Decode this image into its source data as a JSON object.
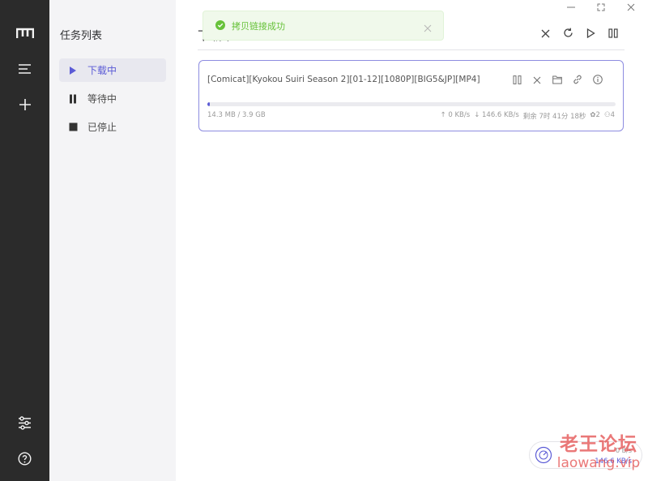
{
  "rail": {
    "logo_icon": "app-logo-m",
    "items": [
      "task-list-icon",
      "add-task-icon"
    ],
    "bottom": [
      "settings-sliders-icon",
      "help-icon"
    ]
  },
  "nav": {
    "title": "任务列表",
    "items": [
      {
        "label": "下载中",
        "icon": "play-icon",
        "active": true
      },
      {
        "label": "等待中",
        "icon": "pause-icon",
        "active": false
      },
      {
        "label": "已停止",
        "icon": "stop-icon",
        "active": false
      }
    ]
  },
  "header": {
    "title": "下载中",
    "actions": [
      "close-icon",
      "refresh-icon",
      "resume-all-icon",
      "pause-all-icon"
    ]
  },
  "toast": {
    "message": "拷贝链接成功",
    "type": "success"
  },
  "task": {
    "name": "[Comicat][Kyokou Suiri Season 2][01-12][1080P][BIG5&JP][MP4]",
    "size": "14.3 MB / 3.9 GB",
    "progress_fraction": 0.004,
    "upload_speed": "↑ 0 KB/s",
    "download_speed": "↓ 146.6 KB/s",
    "remaining": "剩余 7时 41分 18秒",
    "seeders": "2",
    "peers": "4",
    "actions": [
      "pause-icon",
      "delete-icon",
      "folder-icon",
      "link-icon",
      "info-icon"
    ]
  },
  "speed_widget": {
    "upload": "0 B/s",
    "download": "146.6 KB/s"
  },
  "watermark": {
    "line1": "老王论坛",
    "line2": "laowang.vip"
  },
  "colors": {
    "accent": "#5b5bd6",
    "rail_bg": "#2b2b2b",
    "nav_bg": "#f4f4f6",
    "toast_bg": "#f0f9eb",
    "toast_text": "#67c23a"
  }
}
